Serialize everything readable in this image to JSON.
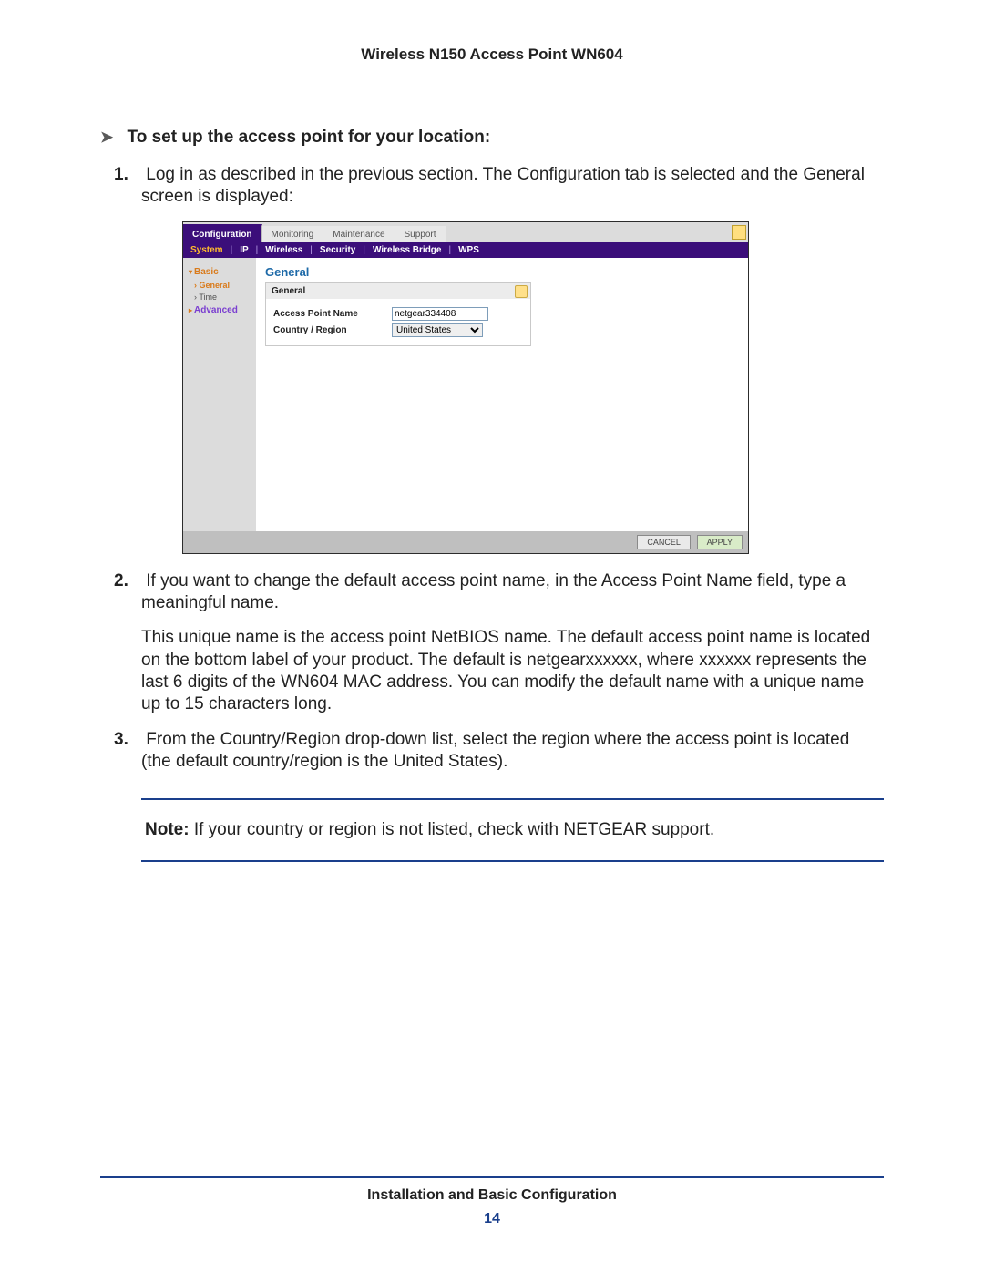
{
  "header": {
    "title": "Wireless N150 Access Point WN604"
  },
  "task_heading": "To set up the access point for your location:",
  "steps": {
    "s1": {
      "num": "1.",
      "text": "Log in as described in the previous section. The Configuration tab is selected and the General screen is displayed:"
    },
    "s2": {
      "num": "2.",
      "text": "If you want to change the default access point name, in the Access Point Name field, type a meaningful name."
    },
    "s2b": "This unique name is the access point NetBIOS name. The default access point name is located on the bottom label of your product. The default is netgearxxxxxx, where xxxxxx represents the last 6 digits of the WN604 MAC address. You can modify the default name with a unique name up to 15 characters long.",
    "s3": {
      "num": "3.",
      "text": "From the Country/Region drop-down list, select the region where the access point is located (the default country/region is the United States)."
    }
  },
  "note": {
    "label": "Note:",
    "text": " If your country or region is not listed, check with NETGEAR support."
  },
  "footer": {
    "section": "Installation and Basic Configuration",
    "page": "14"
  },
  "shot": {
    "top_tabs": {
      "configuration": "Configuration",
      "monitoring": "Monitoring",
      "maintenance": "Maintenance",
      "support": "Support"
    },
    "sub_tabs": {
      "system": "System",
      "ip": "IP",
      "wireless": "Wireless",
      "security": "Security",
      "wbridge": "Wireless Bridge",
      "wps": "WPS"
    },
    "sidebar": {
      "basic": "Basic",
      "general": "General",
      "time": "Time",
      "advanced": "Advanced"
    },
    "panel": {
      "page_title": "General",
      "box_title": "General",
      "ap_name_label": "Access Point Name",
      "ap_name_value": "netgear334408",
      "country_label": "Country / Region",
      "country_value": "United States"
    },
    "buttons": {
      "cancel": "CANCEL",
      "apply": "APPLY"
    }
  }
}
